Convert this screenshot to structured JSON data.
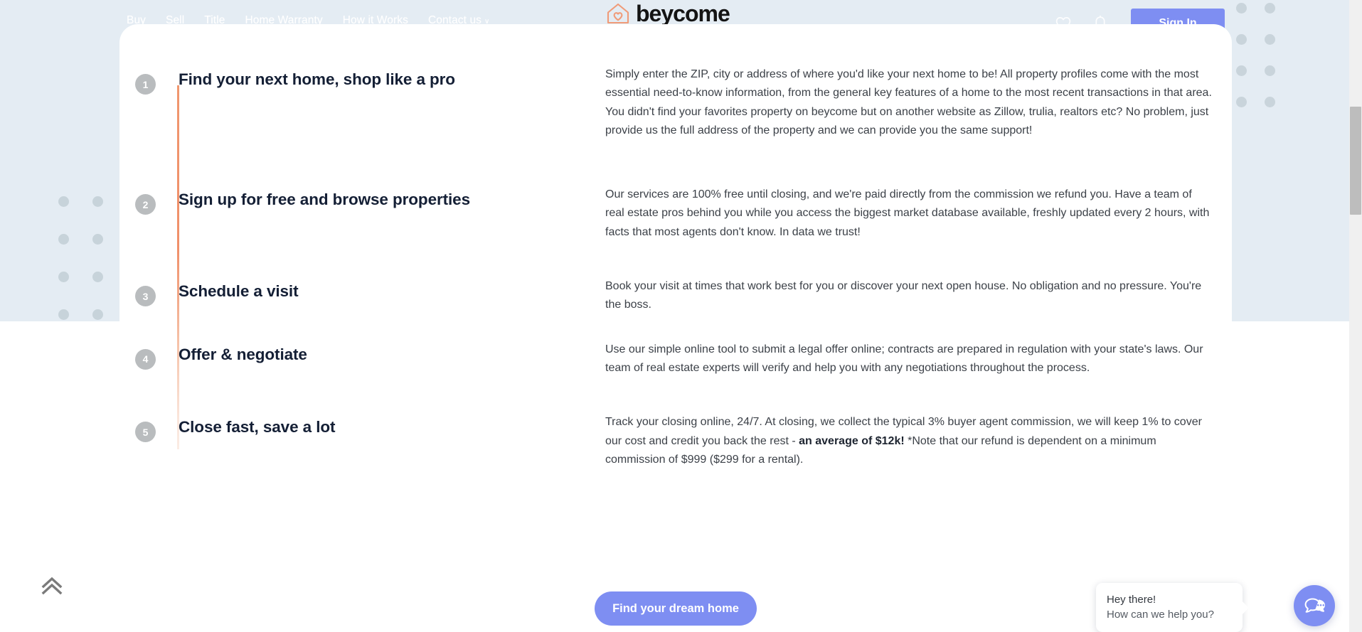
{
  "nav": {
    "links": [
      {
        "label": "Buy",
        "caret": false
      },
      {
        "label": "Sell",
        "caret": false
      },
      {
        "label": "Title",
        "caret": false
      },
      {
        "label": "Home Warranty",
        "caret": false
      },
      {
        "label": "How it Works",
        "caret": false
      },
      {
        "label": "Contact us",
        "caret": true
      }
    ],
    "caret_glyph": "∨",
    "brand": "beycome",
    "brand_icon": "house-heart-logo-icon",
    "favorites_icon": "heart-icon",
    "notifications_icon": "bell-icon",
    "sign_in": "Sign In"
  },
  "steps": [
    {
      "number": "1",
      "title": "Find your next home, shop like a pro",
      "body_plain": "Simply enter the ZIP, city or address of where you'd like your next home to be! All property profiles come with the most essential need-to-know information, from the general key features of a home to the most recent transactions in that area. You didn't find your favorites property on beycome but on another website as Zillow, trulia, realtors etc? No problem, just provide us the full address of the property and we can provide you the same support!",
      "body_parts": [
        {
          "text": "Simply enter the ZIP, city or address of where you'd like your next home to be! All property profiles come with the most essential need-to-know information, from the general key features of a home to the most recent transactions in that area. You didn't find your favorites property on beycome but on another website as Zillow, trulia, realtors etc? No problem, just provide us the full address of the property and we can provide you the same support!",
          "bold": false
        }
      ]
    },
    {
      "number": "2",
      "title": "Sign up for free and browse properties",
      "body_plain": "Our services are 100% free until closing, and we're paid directly from the commission we refund you. Have a team of real estate pros behind you while you access the biggest market database available, freshly updated every 2 hours, with facts that most agents don't know. In data we trust!",
      "body_parts": [
        {
          "text": "Our services are 100% free until closing, and we're paid directly from the commission we refund you. Have a team of real estate pros behind you while you access the biggest market database available, freshly updated every 2 hours, with facts that most agents don't know. In data we trust!",
          "bold": false
        }
      ]
    },
    {
      "number": "3",
      "title": "Schedule a visit",
      "body_plain": "Book your visit at times that work best for you or discover your next open house. No obligation and no pressure. You're the boss.",
      "body_parts": [
        {
          "text": "Book your visit at times that work best for you or discover your next open house. No obligation and no pressure. You're the boss.",
          "bold": false
        }
      ]
    },
    {
      "number": "4",
      "title": "Offer & negotiate",
      "body_plain": "Use our simple online tool to submit a legal offer online; contracts are prepared in regulation with your state's laws. Our team of real estate experts will verify and help you with any negotiations throughout the process.",
      "body_parts": [
        {
          "text": "Use our simple online tool to submit a legal offer online; contracts are prepared in regulation with your state's laws. Our team of real estate experts will verify and help you with any negotiations throughout the process.",
          "bold": false
        }
      ]
    },
    {
      "number": "5",
      "title": "Close fast, save a lot",
      "body_plain": "Track your closing online, 24/7. At closing, we collect the typical 3% buyer agent commission, we will keep 1% to cover our cost and credit you back the rest - an average of $12k! *Note that our refund is dependent on a minimum commission of $999 ($299 for a rental).",
      "body_parts": [
        {
          "text": "Track your closing online, 24/7. At closing, we collect the typical 3% buyer agent commission, we will keep 1% to cover our cost and credit you back the rest - ",
          "bold": false
        },
        {
          "text": "an average of $12k!",
          "bold": true
        },
        {
          "text": " *Note that our refund is dependent on a minimum commission of $999 ($299 for a rental).",
          "bold": false
        }
      ]
    }
  ],
  "cta": {
    "label": "Find your dream home"
  },
  "scroll_top": {
    "icon": "double-chevron-up-icon"
  },
  "chat": {
    "greeting": "Hey there!",
    "prompt": "How can we help you?",
    "icon": "chat-bubbles-icon"
  },
  "colors": {
    "accent_blue": "#7e8ef2",
    "timeline_salmon": "#f0916a",
    "badge_gray": "#b9bcbe",
    "heading_navy": "#141f35",
    "page_blue": "#e4ecf3"
  }
}
